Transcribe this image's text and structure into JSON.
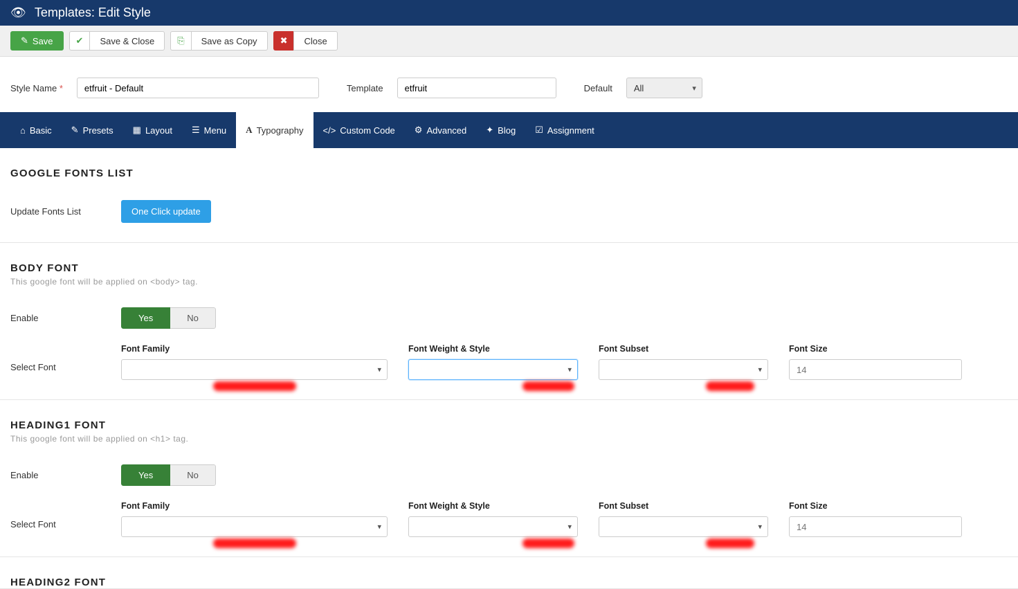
{
  "header": {
    "title": "Templates: Edit Style"
  },
  "toolbar": {
    "save": "Save",
    "save_close": "Save & Close",
    "save_copy": "Save as Copy",
    "close": "Close"
  },
  "form": {
    "style_name_label": "Style Name",
    "style_name_value": "etfruit - Default",
    "template_label": "Template",
    "template_value": "etfruit",
    "default_label": "Default",
    "default_value": "All"
  },
  "tabs": {
    "basic": "Basic",
    "presets": "Presets",
    "layout": "Layout",
    "menu": "Menu",
    "typography": "Typography",
    "custom": "Custom Code",
    "advanced": "Advanced",
    "blog": "Blog",
    "assignment": "Assignment"
  },
  "sections": {
    "google_fonts": {
      "title": "GOOGLE FONTS LIST",
      "update_label": "Update Fonts List",
      "update_btn": "One Click update"
    },
    "body_font": {
      "title": "BODY FONT",
      "desc": "This google font will be applied on <body> tag.",
      "enable_label": "Enable",
      "yes": "Yes",
      "no": "No",
      "select_label": "Select Font",
      "family": "Font Family",
      "weight": "Font Weight & Style",
      "subset": "Font Subset",
      "size": "Font Size",
      "size_placeholder": "14"
    },
    "h1_font": {
      "title": "HEADING1 FONT",
      "desc": "This google font will be applied on <h1> tag.",
      "enable_label": "Enable",
      "yes": "Yes",
      "no": "No",
      "select_label": "Select Font",
      "family": "Font Family",
      "weight": "Font Weight & Style",
      "subset": "Font Subset",
      "size": "Font Size",
      "size_placeholder": "14"
    },
    "h2_font": {
      "title": "HEADING2 FONT"
    }
  }
}
